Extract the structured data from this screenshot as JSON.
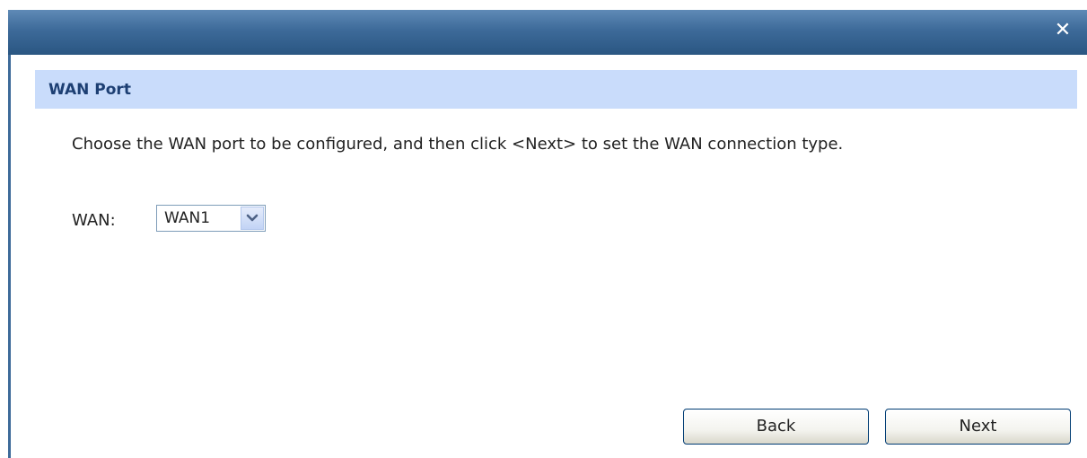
{
  "dialog": {
    "close_icon": "close-icon",
    "accent_color": "#3d6a99"
  },
  "section": {
    "title": "WAN Port",
    "header_color": "#c9dcfb"
  },
  "description": "Choose the WAN port to be configured, and then click <Next> to set the WAN connection type.",
  "wan": {
    "label": "WAN:",
    "selected": "WAN1"
  },
  "buttons": {
    "back_label": "Back",
    "next_label": "Next"
  }
}
